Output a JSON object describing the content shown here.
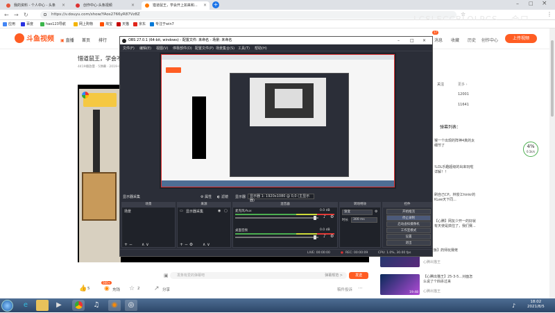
{
  "browser": {
    "tabs": [
      {
        "label": "我的资料 - 个人中心 - 头条"
      },
      {
        "label": "创作中心-头条视频"
      },
      {
        "label": "猎道鼠王，学会开上如来和..."
      }
    ],
    "url": "https://v.douyu.com/show/YAos2766yR87Vz8Z",
    "bookmarks": [
      "应用",
      "百度",
      "hao123导航",
      "网上购物",
      "淘宝",
      "天猫",
      "京东",
      "专注于win7"
    ],
    "watermark": "LCSLECCBLOLPCS... 合口"
  },
  "site": {
    "logo_text": "斗鱼视频",
    "nav": [
      "首页",
      "排行"
    ],
    "header_right": [
      "消息",
      "收藏",
      "历史",
      "创作中心"
    ],
    "badge": "17",
    "upload_label": "上传视频",
    "video_title": "惜道鼠王，学会不",
    "video_meta": "4419播放量 · 5弹幕 · 2019-08-16 ...",
    "danmu_input_placeholder": "发条有爱的弹幕吧",
    "danmu_setting": "弹幕规范 >",
    "send_label": "发送",
    "likes": "5",
    "coins": "充钱",
    "fav_count": "2",
    "share": "分享",
    "report": "稿件投诉",
    "coin_badge": "560+",
    "right_col": {
      "rows": [
        {
          "label": "关注",
          "value": "12001"
        },
        {
          "label": "",
          "value": "11641"
        }
      ],
      "list_title": "弹幕列表：",
      "items": [
        {
          "title": "猴一个出现的阵神4真的太细节了"
        },
        {
          "title": "!LOL乐趣超级的出来玩啦详解！！"
        },
        {
          "title": "刷自己CP，林俊江hinkr的KLee天下同..."
        },
        {
          "title": "【心腾】网友少开一的好就有天使是搞住了，我们赛..."
        },
        {
          "title": "【宁老板】药师玩赛佬"
        },
        {
          "title": "【心腾出猫王】25-3-5...对面怎么说了个四杀过来"
        }
      ],
      "authors": [
        "心腾出猫王",
        "心腾出猫王"
      ],
      "durations": [
        "19:48"
      ]
    },
    "speed_percent": "4%",
    "speed_rate": "0.1k/s"
  },
  "obs": {
    "title": "OBS 27.0.1 (64-bit, windows) - 配置文件: 未命名 - 场景: 未命名",
    "menu": [
      "文件(F)",
      "编辑(E)",
      "视图(V)",
      "停靠部件(D)",
      "配置文件(P)",
      "场景集合(S)",
      "工具(T)",
      "帮助(H)"
    ],
    "scene_info": {
      "source_label": "显示器采集",
      "properties": "属性",
      "filters": "滤镜",
      "display_label": "显示器",
      "display_value": "显示器 1: 1920x1080 @ 0,0 (主显示器)"
    },
    "docks": {
      "scenes": {
        "header": "场景",
        "items": [
          "场景"
        ]
      },
      "sources": {
        "header": "来源",
        "items": [
          "显示器采集"
        ]
      },
      "mixer": {
        "header": "混音器",
        "tracks": [
          {
            "name": "麦克风/Aux",
            "db": "0.0 dB"
          },
          {
            "name": "桌面音频",
            "db": "0.0 dB"
          }
        ]
      },
      "transitions": {
        "header": "转场特效",
        "type": "渐变",
        "duration_label": "时长",
        "duration": "300 ms"
      },
      "controls": {
        "header": "控件",
        "buttons": [
          "开始推流",
          "停止录制",
          "启动虚拟摄像机",
          "工作室模式",
          "设置",
          "退出"
        ]
      }
    },
    "status": {
      "live": "LIVE: 00:00:00",
      "rec": "REC: 00:00:09",
      "cpu": "CPU: 1.0%, 30.00 fps"
    }
  },
  "taskbar": {
    "time": "18:02",
    "date": "2021/8/5"
  },
  "colors": {
    "accent": "#ff5d23",
    "obs_bg": "#2b2e38",
    "rec_red": "#e03131"
  }
}
